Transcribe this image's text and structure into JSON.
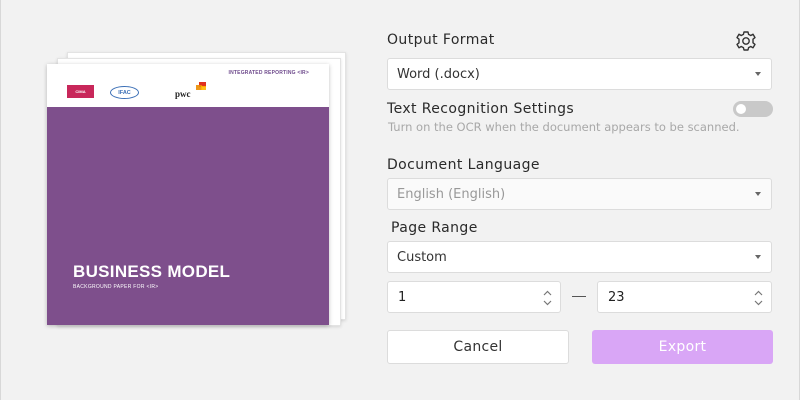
{
  "preview": {
    "cover": {
      "tag": "INTEGRATED REPORTING <IR>",
      "logo_a": "CIMA",
      "logo_a_sub": "",
      "logo_b": "IFAC",
      "logo_b_sub": "",
      "logo_c": "pwc",
      "title": "BUSINESS MODEL",
      "subtitle": "BACKGROUND PAPER FOR <IR>",
      "colors": {
        "band": "#7e4f8c"
      }
    }
  },
  "output_format": {
    "label": "Output Format",
    "value": "Word (.docx)",
    "settings_icon": "gear-icon"
  },
  "ocr": {
    "label": "Text Recognition Settings",
    "hint": "Turn on the OCR when the document appears to be scanned.",
    "enabled": false
  },
  "language": {
    "label": "Document Language",
    "value": "English (English)"
  },
  "page_range": {
    "label": "Page Range",
    "value": "Custom",
    "from": "1",
    "to": "23"
  },
  "buttons": {
    "cancel": "Cancel",
    "export": "Export"
  },
  "colors": {
    "accent": "#d9a6f6",
    "toggle_off": "#c9c9c9"
  }
}
